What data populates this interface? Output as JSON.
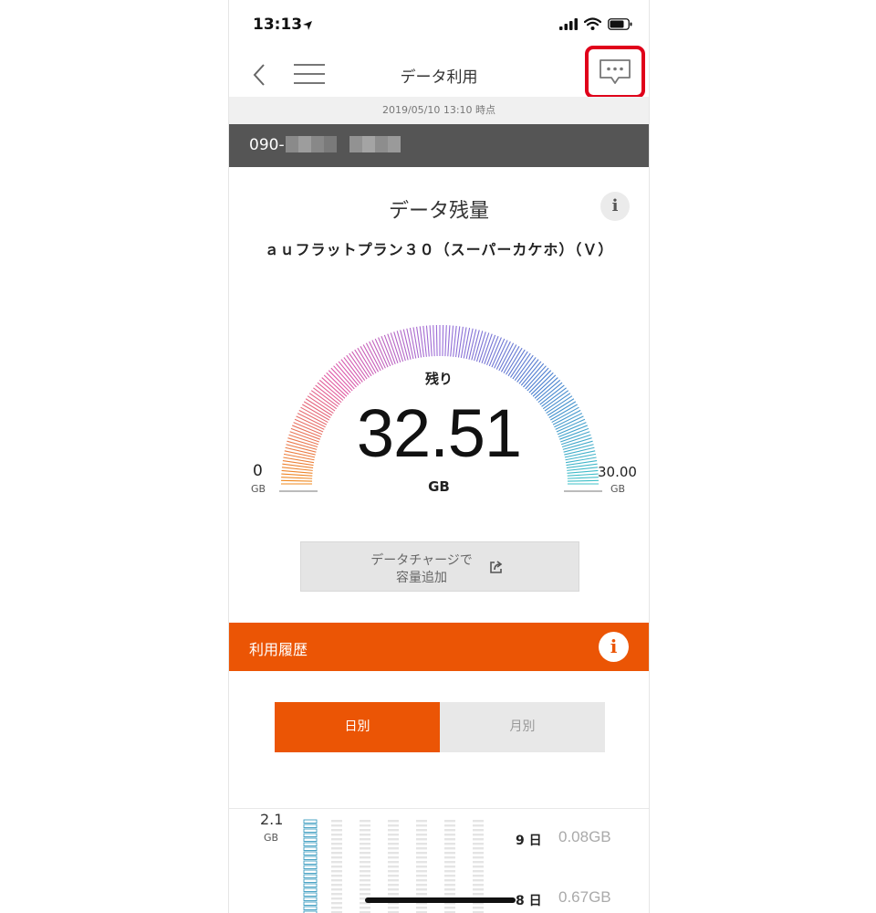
{
  "status_bar": {
    "time": "13:13"
  },
  "nav": {
    "title": "データ利用"
  },
  "timestamp": "2019/05/10 13:10 時点",
  "phone": {
    "number_prefix": "090-"
  },
  "remaining": {
    "title": "データ残量",
    "plan_name": "ａｕフラットプラン３０（スーパーカケホ）（Ｖ）",
    "label": "残り",
    "value": "32.51",
    "unit": "GB",
    "gauge_min": "0",
    "gauge_min_unit": "GB",
    "gauge_max": "30.00",
    "gauge_max_unit": "GB",
    "gauge_colors": [
      "#f08a1c",
      "#e05aa8",
      "#9a6cd8",
      "#4a7fd0",
      "#3ec2c8"
    ]
  },
  "charge_button": {
    "line1": "データチャージで",
    "line2": "容量追加"
  },
  "history": {
    "title": "利用履歴",
    "tabs": {
      "daily": "日別",
      "monthly": "月別"
    },
    "chart_max": "2.1",
    "chart_max_unit": "GB",
    "days": [
      {
        "day": "9 日",
        "usage": "0.08GB"
      },
      {
        "day": "8 日",
        "usage": "0.67GB"
      }
    ]
  }
}
